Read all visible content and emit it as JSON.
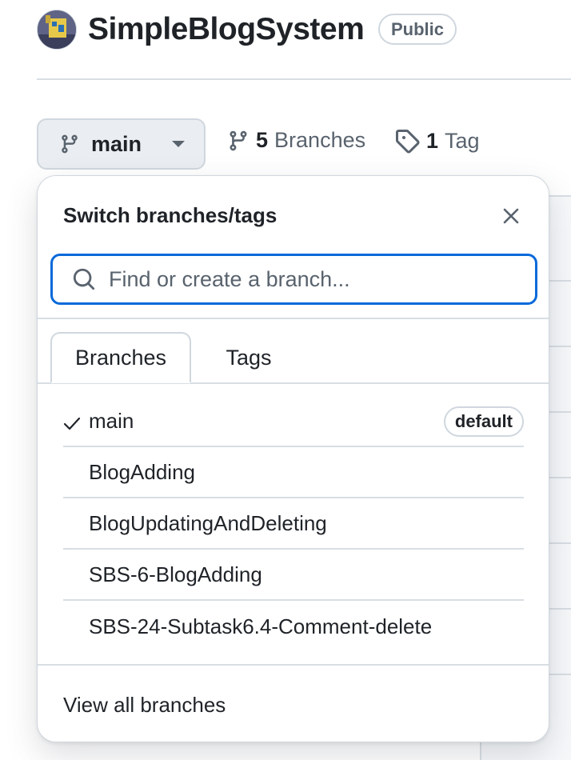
{
  "repo": {
    "name": "SimpleBlogSystem",
    "visibility": "Public"
  },
  "branch_button": {
    "current": "main",
    "icon": "git-branch-icon"
  },
  "branches_link": {
    "count": "5",
    "label": "Branches",
    "icon": "git-branch-icon"
  },
  "tags_link": {
    "count": "1",
    "label": "Tag",
    "icon": "tag-icon"
  },
  "dropdown": {
    "title": "Switch branches/tags",
    "search_placeholder": "Find or create a branch...",
    "tabs": [
      {
        "label": "Branches",
        "active": true
      },
      {
        "label": "Tags",
        "active": false
      }
    ],
    "branches": [
      {
        "name": "main",
        "selected": true,
        "badge": "default"
      },
      {
        "name": "BlogAdding",
        "selected": false
      },
      {
        "name": "BlogUpdatingAndDeleting",
        "selected": false
      },
      {
        "name": "SBS-6-BlogAdding",
        "selected": false
      },
      {
        "name": "SBS-24-Subtask6.4-Comment-delete",
        "selected": false
      }
    ],
    "view_all": "View all branches"
  },
  "colors": {
    "accent": "#0969da",
    "text": "#1f2328",
    "muted": "#59636e",
    "border": "#d0d7de"
  }
}
